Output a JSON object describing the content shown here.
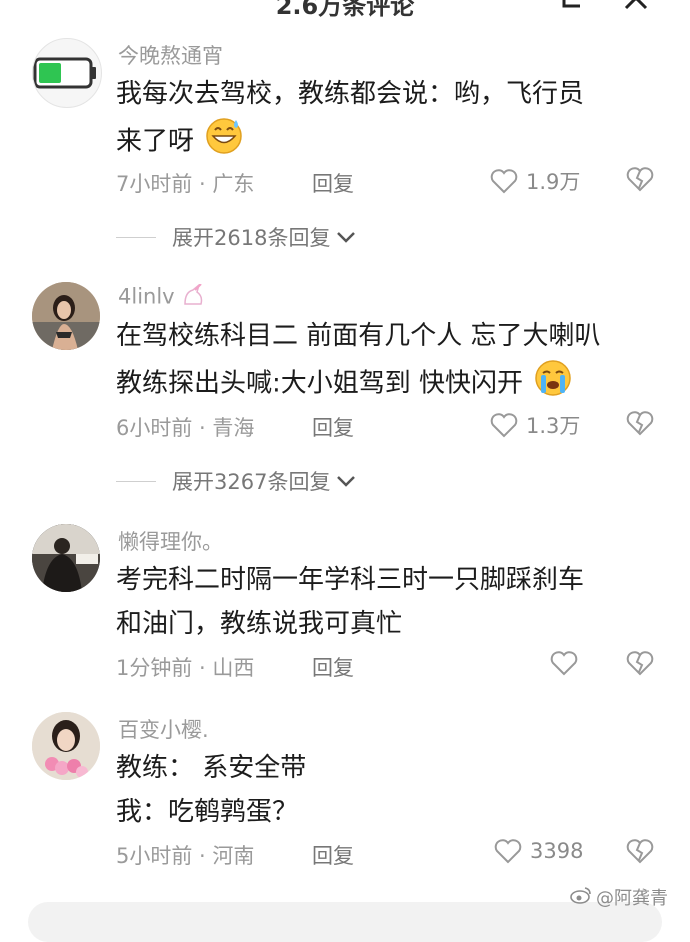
{
  "header": {
    "title": "2.6万条评论"
  },
  "comments": [
    {
      "username": "今晚熬通宵",
      "lines": [
        "我每次去驾校，教练都会说：哟，飞行员",
        "来了呀"
      ],
      "emoji": "grinning-sweat",
      "time_location": "7小时前 · 广东",
      "reply": "回复",
      "likes": "1.9万",
      "expand": "展开2618条回复"
    },
    {
      "username": "4linlv",
      "lines": [
        "在驾校练科目二 前面有几个人  忘了大喇叭",
        "教练探出头喊:大小姐驾到 快快闪开"
      ],
      "emoji": "crying",
      "time_location": "6小时前 · 青海",
      "reply": "回复",
      "likes": "1.3万",
      "expand": "展开3267条回复"
    },
    {
      "username": "懒得理你。",
      "lines": [
        "考完科二时隔一年学科三时一只脚踩刹车",
        "和油门，教练说我可真忙"
      ],
      "time_location": "1分钟前 · 山西",
      "reply": "回复",
      "likes": ""
    },
    {
      "username": "百变小樱.",
      "lines": [
        "教练：  系安全带",
        "我：吃鹌鹑蛋？"
      ],
      "time_location": "5小时前 · 河南",
      "reply": "回复",
      "likes": "3398"
    }
  ],
  "watermark": "@阿龚青",
  "colors": {
    "battery_green": "#2fc552",
    "text": "#1c1c1c",
    "meta": "#9a9a9a"
  }
}
